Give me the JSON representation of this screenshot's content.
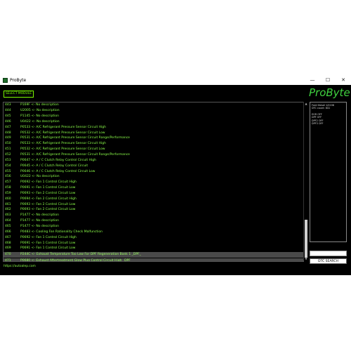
{
  "window": {
    "title": "ProByte",
    "minimize": "—",
    "maximize": "☐",
    "close": "✕"
  },
  "toolbar": {
    "select_module": "SELECT MODULE"
  },
  "logo": "ProByte",
  "dtc_list": [
    {
      "num": "443",
      "text": "P169F <- No description"
    },
    {
      "num": "444",
      "text": "U2005 <- No description"
    },
    {
      "num": "445",
      "text": "P1145 <- No description"
    },
    {
      "num": "446",
      "text": "U0422 <- No description"
    },
    {
      "num": "447",
      "text": "P0533 <- A/C Refrigerant Pressure Sensor Circuit High"
    },
    {
      "num": "448",
      "text": "P0532 <- A/C Refrigerant Pressure Sensor Circuit Low"
    },
    {
      "num": "449",
      "text": "P0531 <- A/C Refrigerant Pressure Sensor Circuit Range/Performance"
    },
    {
      "num": "450",
      "text": "P0533 <- A/C Refrigerant Pressure Sensor Circuit High"
    },
    {
      "num": "451",
      "text": "P0532 <- A/C Refrigerant Pressure Sensor Circuit Low"
    },
    {
      "num": "452",
      "text": "P0531 <- A/C Refrigerant Pressure Sensor Circuit Range/Performance"
    },
    {
      "num": "453",
      "text": "P0647 <- A / C Clutch Relay Control Circuit High"
    },
    {
      "num": "454",
      "text": "P0645 <- A / C Clutch Relay Control Circuit"
    },
    {
      "num": "455",
      "text": "P0646 <- A / C Clutch Relay Control Circuit Low"
    },
    {
      "num": "456",
      "text": "U0422 <- No description"
    },
    {
      "num": "457",
      "text": "P0692 <- Fan 1 Control Circuit High"
    },
    {
      "num": "458",
      "text": "P0691 <- Fan 1 Control Circuit Low"
    },
    {
      "num": "459",
      "text": "P0693 <- Fan 2 Control Circuit Low"
    },
    {
      "num": "460",
      "text": "P0694 <- Fan 2 Control Circuit High"
    },
    {
      "num": "461",
      "text": "P0693 <- Fan 2 Control Circuit Low"
    },
    {
      "num": "462",
      "text": "P0693 <- Fan 2 Control Circuit Low"
    },
    {
      "num": "463",
      "text": "P1477 <- No description"
    },
    {
      "num": "464",
      "text": "P1477 <- No description"
    },
    {
      "num": "465",
      "text": "P1477 <- No description"
    },
    {
      "num": "466",
      "text": "P0483 <- Cooling Fan Rationality Check Malfunction"
    },
    {
      "num": "467",
      "text": "P0692 <- Fan 1 Control Circuit High"
    },
    {
      "num": "468",
      "text": "P0691 <- Fan 1 Control Circuit Low"
    },
    {
      "num": "469",
      "text": "P0691 <- Fan 1 Control Circuit Low"
    },
    {
      "num": "470",
      "text": "P244C <- Exhaust Temperature Too Low For DPF Regeneration Bank 1 _DPF_",
      "selected": true
    },
    {
      "num": "471",
      "text": "P0680 <- Exhaust Aftertreatment Glow Plug Control Circuit High _DPF_",
      "selected": true
    }
  ],
  "info_panel": {
    "lines": [
      "Ford Diesel 1/2208",
      "DTC count: 841"
    ],
    "items": [
      "EGR OFF",
      "DPF OFF",
      "DPF2 OFF",
      "DPF3 OFF"
    ]
  },
  "search": {
    "placeholder": "",
    "button_label": "DTC SEARCH"
  },
  "status": {
    "link": "https://autoalep.com"
  },
  "colors": {
    "text_green": "#8cff4a",
    "logo_green": "#3fd13f",
    "background": "#000000",
    "selected_row": "#4a4a4a"
  }
}
